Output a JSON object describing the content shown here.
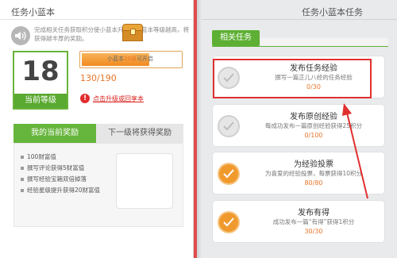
{
  "left": {
    "title": "任务小蓝本",
    "intro": "完成相关任务获取积分使小蓝本升级，小蓝本等级越高，将获得越丰厚的奖励。",
    "level": {
      "value": "18",
      "label": "当前等级"
    },
    "exp": {
      "text": "130/190",
      "current": 130,
      "max": 190
    },
    "upgrade_link": "点击升级或回享本",
    "tabs": {
      "current": "我的当前奖励",
      "next": "下一级将获得奖励"
    },
    "rewards": [
      "100财富值",
      "撰写评论获得5财富值",
      "撰写经验宝箱双倍掉落",
      "经验星级提升获得20财富值"
    ],
    "chest_text_before": "小蓝本",
    "chest_text_highlight": "20级",
    "chest_text_after": "可开启"
  },
  "right": {
    "title": "任务小蓝本任务",
    "section_tab": "相关任务",
    "tasks": [
      {
        "title": "发布任务经验",
        "desc": "撰写一篇正儿八经的任务经验",
        "progress": "0/30",
        "done": false
      },
      {
        "title": "发布原创经验",
        "desc": "每成功发布一篇原创经验获得25积分",
        "progress": "0/100",
        "done": false
      },
      {
        "title": "为经验投票",
        "desc": "为喜爱的经验投票，每票获得10积分",
        "progress": "80/80",
        "done": true
      },
      {
        "title": "发布有得",
        "desc": "成功发布一篇“有得”获得1积分",
        "progress": "30/30",
        "done": true
      }
    ]
  },
  "colors": {
    "green": "#5eb034",
    "orange": "#e8742a",
    "red": "#e03030"
  }
}
